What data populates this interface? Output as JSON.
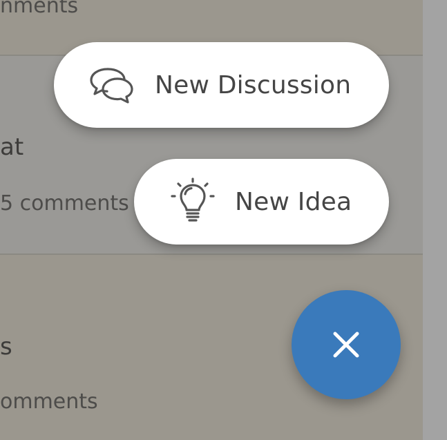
{
  "background_list": {
    "items": [
      {
        "title": "",
        "comments_label": "nments"
      },
      {
        "title": "at",
        "comments_label": "5 comments"
      },
      {
        "title": "s",
        "comments_label": "omments"
      }
    ]
  },
  "speed_dial": {
    "actions": [
      {
        "label": "New Discussion",
        "icon": "chat-bubbles-icon"
      },
      {
        "label": "New Idea",
        "icon": "lightbulb-icon"
      }
    ],
    "close_button": {
      "icon": "close-icon",
      "color": "#3a7abb"
    }
  },
  "colors": {
    "overlay": "#9e9c98",
    "fab": "#3a7abb",
    "pill_text": "#454545",
    "icon_stroke": "#555555"
  }
}
